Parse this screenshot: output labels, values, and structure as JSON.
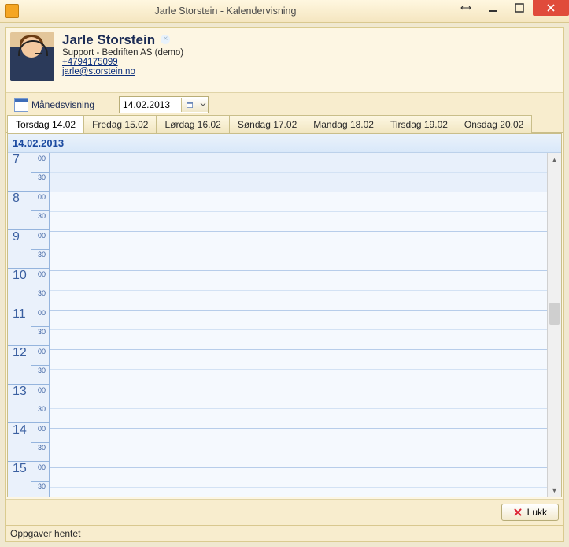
{
  "window": {
    "title": "Jarle Storstein - Kalendervisning"
  },
  "contact": {
    "name": "Jarle Storstein",
    "role": "Support - Bedriften AS (demo)",
    "phone": "+4794175099",
    "email": "jarle@storstein.no"
  },
  "toolbar": {
    "month_view_label": "Månedsvisning",
    "date_value": "14.02.2013"
  },
  "tabs": [
    {
      "label": "Torsdag 14.02",
      "active": true
    },
    {
      "label": "Fredag 15.02",
      "active": false
    },
    {
      "label": "Lørdag 16.02",
      "active": false
    },
    {
      "label": "Søndag 17.02",
      "active": false
    },
    {
      "label": "Mandag 18.02",
      "active": false
    },
    {
      "label": "Tirsdag 19.02",
      "active": false
    },
    {
      "label": "Onsdag 20.02",
      "active": false
    }
  ],
  "calendar": {
    "day_header": "14.02.2013",
    "hours": [
      7,
      8,
      9,
      10,
      11,
      12,
      13,
      14,
      15
    ],
    "minute_labels": {
      "top": "00",
      "bottom": "30"
    }
  },
  "footer": {
    "close_label": "Lukk"
  },
  "statusbar": {
    "text": "Oppgaver hentet"
  }
}
